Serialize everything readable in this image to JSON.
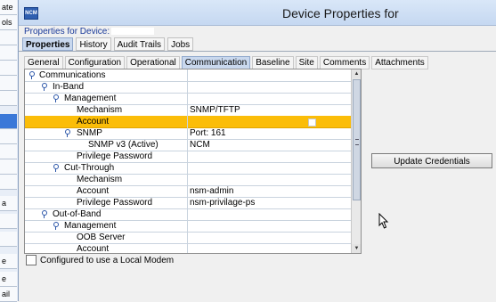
{
  "window": {
    "title": "Device Properties for",
    "app_icon_text": "NCM"
  },
  "left_panel": {
    "items": [
      "ate",
      "ols",
      "",
      "",
      "",
      "",
      "",
      "",
      "",
      "",
      "",
      "a",
      "",
      "",
      "",
      "e",
      "e",
      "ail"
    ]
  },
  "device_line": "Properties for Device:",
  "top_tabs": [
    "Properties",
    "History",
    "Audit Trails",
    "Jobs"
  ],
  "sub_tabs": [
    "General",
    "Configuration",
    "Operational",
    "Communication",
    "Baseline",
    "Site",
    "Comments",
    "Attachments"
  ],
  "tree_rows": [
    {
      "name": "Communications",
      "value": ""
    },
    {
      "name": "In-Band",
      "value": ""
    },
    {
      "name": "Management",
      "value": ""
    },
    {
      "name": "Mechanism",
      "value": "SNMP/TFTP"
    },
    {
      "name": "Account",
      "value": ""
    },
    {
      "name": "SNMP",
      "value": "Port: 161"
    },
    {
      "name": "SNMP v3 (Active)",
      "value": "NCM"
    },
    {
      "name": "Privilege Password",
      "value": ""
    },
    {
      "name": "Cut-Through",
      "value": ""
    },
    {
      "name": "Mechanism",
      "value": ""
    },
    {
      "name": "Account",
      "value": "nsm-admin"
    },
    {
      "name": "Privilege Password",
      "value": "nsm-privilage-ps"
    },
    {
      "name": "Out-of-Band",
      "value": ""
    },
    {
      "name": "Management",
      "value": ""
    },
    {
      "name": "OOB Server",
      "value": ""
    },
    {
      "name": "Account",
      "value": ""
    }
  ],
  "checkbox_label": "Configured to use a Local Modem",
  "update_button": "Update Credentials",
  "colors": {
    "selection": "#fbbd08",
    "tab_active": "#c9d8ee",
    "title_text": "#1a3a9a"
  }
}
